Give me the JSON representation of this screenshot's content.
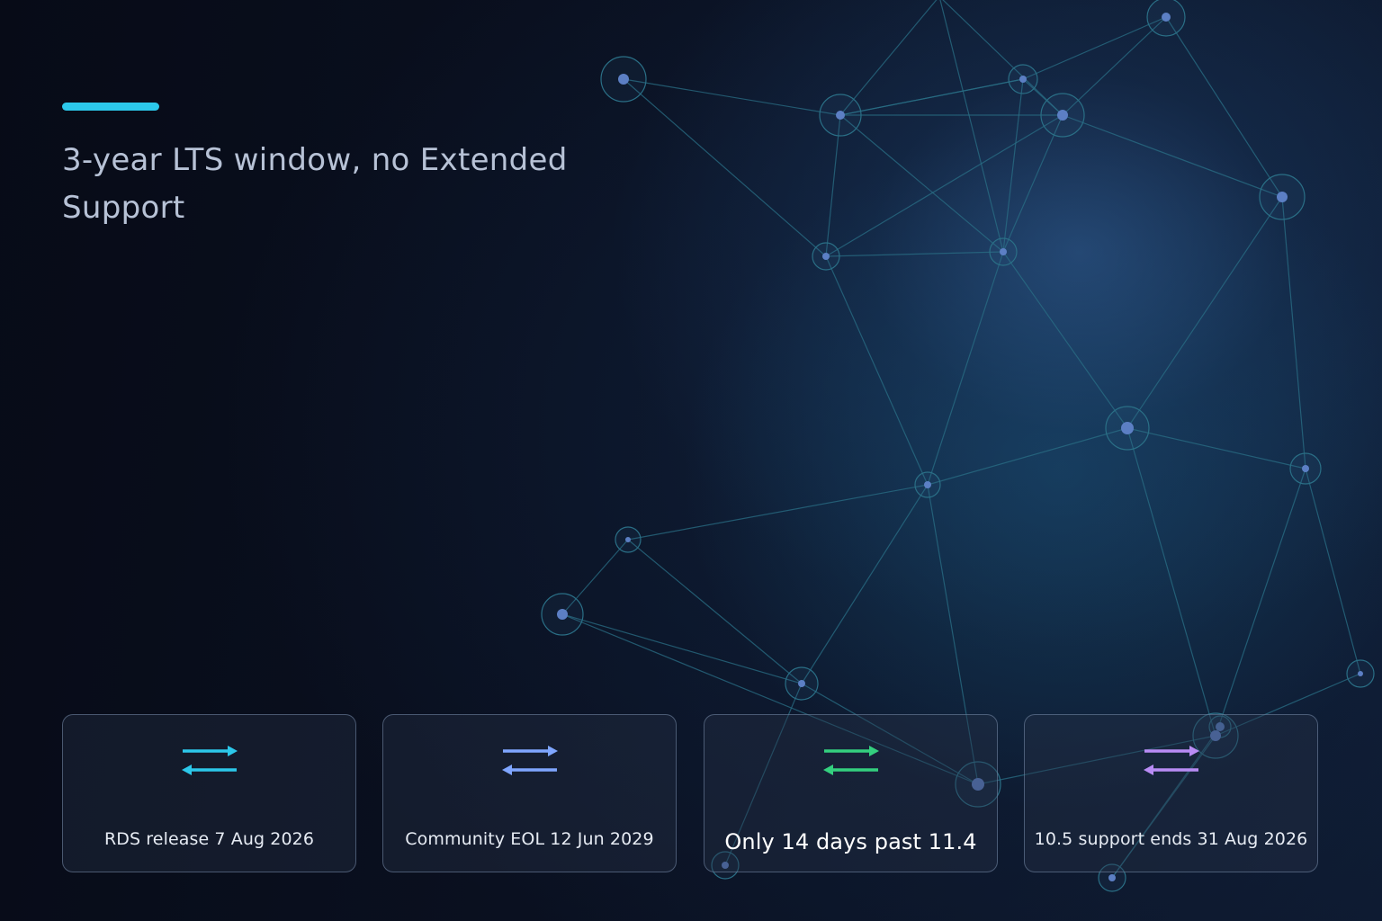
{
  "slide": {
    "title": "3-year LTS window, no Extended Support",
    "accent_color": "#2cc8ea"
  },
  "cards": [
    {
      "label": "RDS release 7 Aug 2026",
      "icon": "swap-arrows-icon",
      "icon_color": "#2cc8ea"
    },
    {
      "label": "Community EOL 12 Jun 2029",
      "icon": "swap-arrows-icon",
      "icon_color": "#7fa6ff"
    },
    {
      "label": "Only 14 days past 11.4",
      "icon": "swap-arrows-icon",
      "icon_color": "#34d07f"
    },
    {
      "label": "10.5 support ends 31 Aug 2026",
      "icon": "swap-arrows-icon",
      "icon_color": "#b98cf5"
    }
  ],
  "background": {
    "decoration": "network-graph",
    "node_color": "#5c7fc4",
    "line_color": "#2a6f86"
  }
}
